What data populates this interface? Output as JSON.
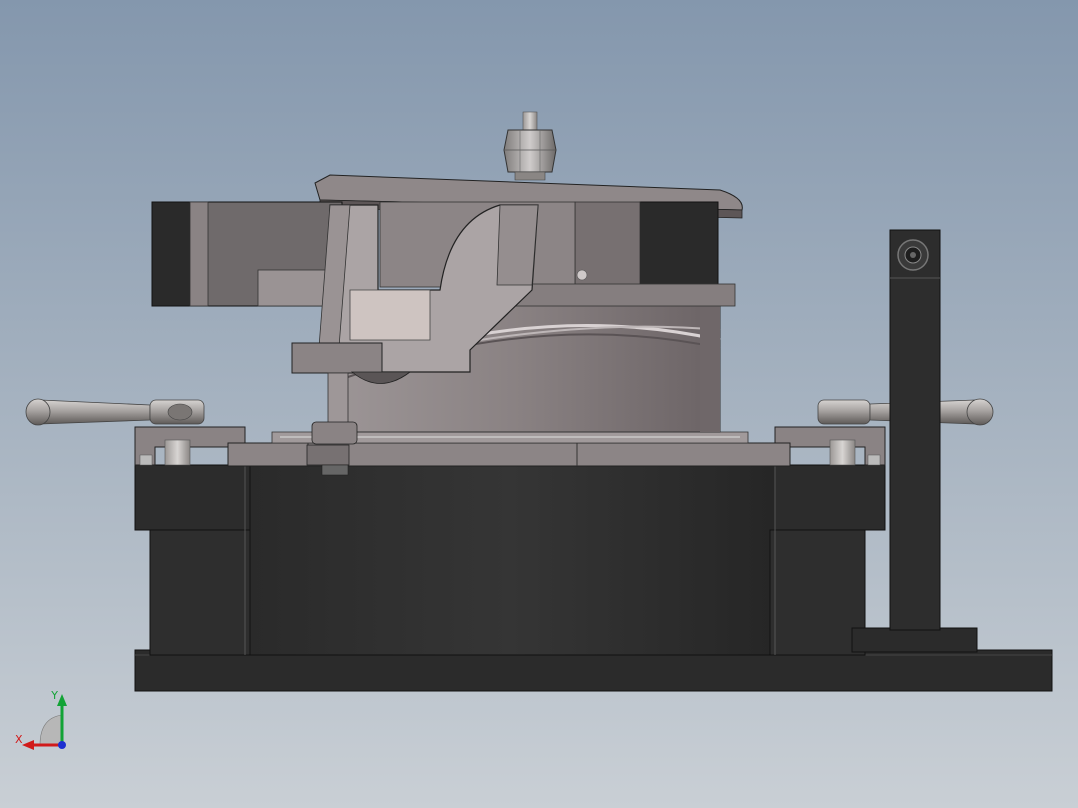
{
  "viewport": {
    "background_top": "#8497ad",
    "background_bottom": "#c9cfd5"
  },
  "triad": {
    "x_label": "X",
    "y_label": "Y",
    "x_color": "#d11a1a",
    "y_color": "#12a336",
    "z_color": "#1d2fd0"
  },
  "model": {
    "body_color": "#2c2c2c",
    "metal_color": "#8a8383",
    "handle_color": "#a8a4a2"
  }
}
